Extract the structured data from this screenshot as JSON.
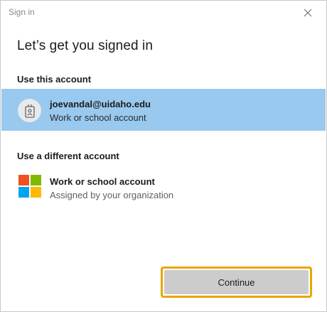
{
  "window": {
    "title": "Sign in"
  },
  "heading": "Let’s get you signed in",
  "sections": {
    "current_label": "Use this account",
    "different_label": "Use a different account"
  },
  "current_account": {
    "email": "joevandal@uidaho.edu",
    "type": "Work or school account",
    "icon": "badge-icon",
    "selected": true
  },
  "other_account": {
    "title": "Work or school account",
    "subtitle": "Assigned by your organization",
    "icon": "microsoft-logo"
  },
  "actions": {
    "continue_label": "Continue"
  },
  "colors": {
    "selection": "#99c9ef",
    "focus_ring": "#e8a600",
    "button": "#cccccc"
  }
}
